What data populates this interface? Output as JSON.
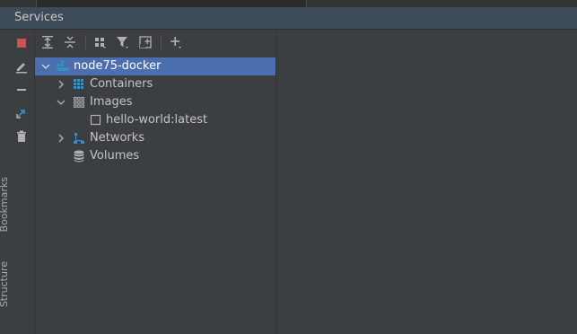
{
  "panel": {
    "title": "Services"
  },
  "side_tabs": {
    "bookmarks": "Bookmarks",
    "structure": "Structure"
  },
  "toolbar": {
    "left_buttons": [
      "stop-icon",
      "edit-icon",
      "minus-icon",
      "expand-arrow-icon",
      "trash-icon"
    ],
    "top_buttons": [
      "expand-all-icon",
      "collapse-all-icon",
      "group-by-icon",
      "filter-icon",
      "new-tab-icon",
      "add-icon"
    ]
  },
  "tree": {
    "root": {
      "label": "node75-docker",
      "expanded": true,
      "selected": true
    },
    "containers": {
      "label": "Containers",
      "expanded": false
    },
    "images": {
      "label": "Images",
      "expanded": true
    },
    "image_item": {
      "label": "hello-world:latest"
    },
    "networks": {
      "label": "Networks",
      "expanded": false
    },
    "volumes": {
      "label": "Volumes"
    }
  },
  "colors": {
    "selection": "#4b6eaf",
    "stop": "#c75450",
    "docker_blue": "#3592c4"
  }
}
